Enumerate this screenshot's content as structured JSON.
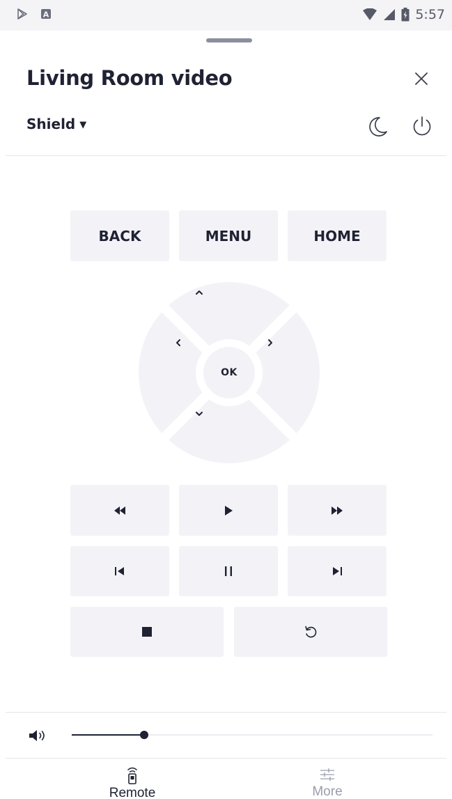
{
  "status_bar": {
    "time": "5:57",
    "icons": [
      "play-store-icon",
      "a-badge-icon",
      "wifi-icon",
      "signal-icon",
      "battery-icon"
    ]
  },
  "header": {
    "title": "Living Room video",
    "close_icon": "close-icon"
  },
  "device": {
    "selected": "Shield",
    "icons": [
      "moon-icon",
      "power-icon"
    ]
  },
  "nav_keys": {
    "back": "BACK",
    "menu": "MENU",
    "home": "HOME"
  },
  "dpad": {
    "ok": "OK",
    "icons": [
      "chevron-up-icon",
      "chevron-down-icon",
      "chevron-left-icon",
      "chevron-right-icon"
    ]
  },
  "media_keys": [
    "rewind-icon",
    "play-icon",
    "fast-forward-icon",
    "skip-previous-icon",
    "pause-icon",
    "skip-next-icon",
    "stop-icon",
    "replay-icon"
  ],
  "volume": {
    "level": 0.2,
    "icon": "speaker-icon"
  },
  "bottom_nav": {
    "remote": "Remote",
    "more": "More"
  },
  "colors": {
    "key_bg": "#f3f3f7",
    "text_dark": "#1f2233",
    "text_muted": "#9a9dab"
  }
}
